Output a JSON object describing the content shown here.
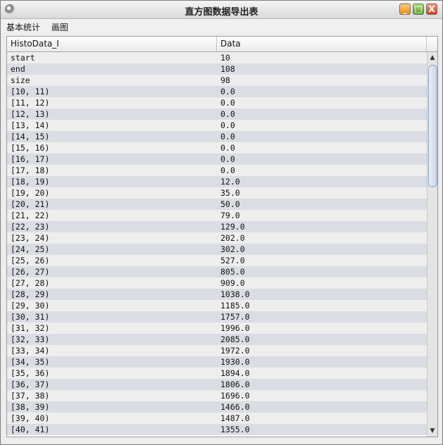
{
  "window": {
    "title": "直方图数据导出表",
    "controls": {
      "minimize": "_",
      "maximize": "□",
      "close": "X"
    }
  },
  "menu": [
    "基本统计",
    "画图"
  ],
  "table": {
    "columns": [
      "HistoData_I",
      "Data"
    ],
    "rows": [
      [
        "start",
        "10"
      ],
      [
        "end",
        "108"
      ],
      [
        "size",
        "98"
      ],
      [
        "[10, 11)",
        "0.0"
      ],
      [
        "[11, 12)",
        "0.0"
      ],
      [
        "[12, 13)",
        "0.0"
      ],
      [
        "[13, 14)",
        "0.0"
      ],
      [
        "[14, 15)",
        "0.0"
      ],
      [
        "[15, 16)",
        "0.0"
      ],
      [
        "[16, 17)",
        "0.0"
      ],
      [
        "[17, 18)",
        "0.0"
      ],
      [
        "[18, 19)",
        "12.0"
      ],
      [
        "[19, 20)",
        "35.0"
      ],
      [
        "[20, 21)",
        "50.0"
      ],
      [
        "[21, 22)",
        "79.0"
      ],
      [
        "[22, 23)",
        "129.0"
      ],
      [
        "[23, 24)",
        "202.0"
      ],
      [
        "[24, 25)",
        "302.0"
      ],
      [
        "[25, 26)",
        "527.0"
      ],
      [
        "[26, 27)",
        "805.0"
      ],
      [
        "[27, 28)",
        "909.0"
      ],
      [
        "[28, 29)",
        "1038.0"
      ],
      [
        "[29, 30)",
        "1185.0"
      ],
      [
        "[30, 31)",
        "1757.0"
      ],
      [
        "[31, 32)",
        "1996.0"
      ],
      [
        "[32, 33)",
        "2085.0"
      ],
      [
        "[33, 34)",
        "1972.0"
      ],
      [
        "[34, 35)",
        "1930.0"
      ],
      [
        "[35, 36)",
        "1894.0"
      ],
      [
        "[36, 37)",
        "1806.0"
      ],
      [
        "[37, 38)",
        "1696.0"
      ],
      [
        "[38, 39)",
        "1466.0"
      ],
      [
        "[39, 40)",
        "1487.0"
      ],
      [
        "[40, 41)",
        "1355.0"
      ]
    ]
  },
  "scrollbar": {
    "up_arrow": "▲",
    "down_arrow": "▼"
  }
}
